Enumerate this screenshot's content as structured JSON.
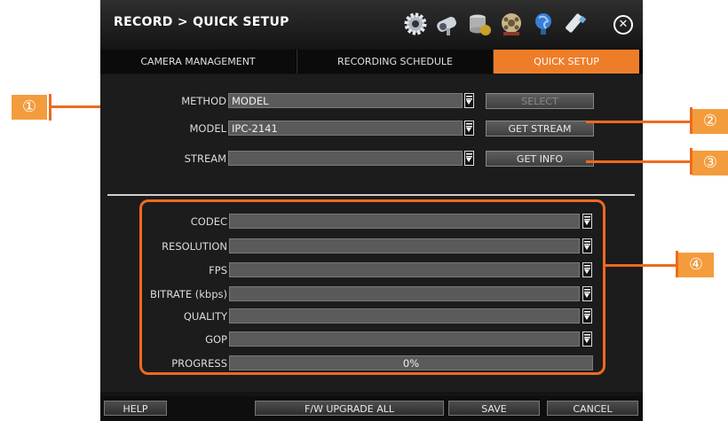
{
  "title": "RECORD > QUICK SETUP",
  "toolbar_icons": [
    "gear-icon",
    "camera-icon",
    "storage-icon",
    "film-reel-icon",
    "network-icon",
    "usb-icon"
  ],
  "tabs": [
    {
      "label": "CAMERA MANAGEMENT",
      "active": false
    },
    {
      "label": "RECORDING SCHEDULE",
      "active": false
    },
    {
      "label": "QUICK SETUP",
      "active": true
    }
  ],
  "top_form": {
    "method": {
      "label": "METHOD",
      "value": "MODEL"
    },
    "model": {
      "label": "MODEL",
      "value": "IPC-2141"
    },
    "stream": {
      "label": "STREAM",
      "value": ""
    },
    "select_button": "SELECT",
    "get_stream_button": "GET STREAM",
    "get_info_button": "GET INFO"
  },
  "settings": {
    "codec": {
      "label": "CODEC",
      "value": ""
    },
    "resolution": {
      "label": "RESOLUTION",
      "value": ""
    },
    "fps": {
      "label": "FPS",
      "value": ""
    },
    "bitrate": {
      "label": "BITRATE (kbps)",
      "value": ""
    },
    "quality": {
      "label": "QUALITY",
      "value": ""
    },
    "gop": {
      "label": "GOP",
      "value": ""
    },
    "progress": {
      "label": "PROGRESS",
      "value": "0%",
      "fraction": 0
    }
  },
  "footer": {
    "help": "HELP",
    "fw_upgrade": "F/W UPGRADE ALL",
    "save": "SAVE",
    "cancel": "CANCEL"
  },
  "callouts": [
    "①",
    "②",
    "③",
    "④"
  ],
  "colors": {
    "accent": "#ee7d2a",
    "callout_fill": "#f39c3d",
    "callout_line": "#ee6a1f",
    "panel": "#1c1c1c"
  }
}
